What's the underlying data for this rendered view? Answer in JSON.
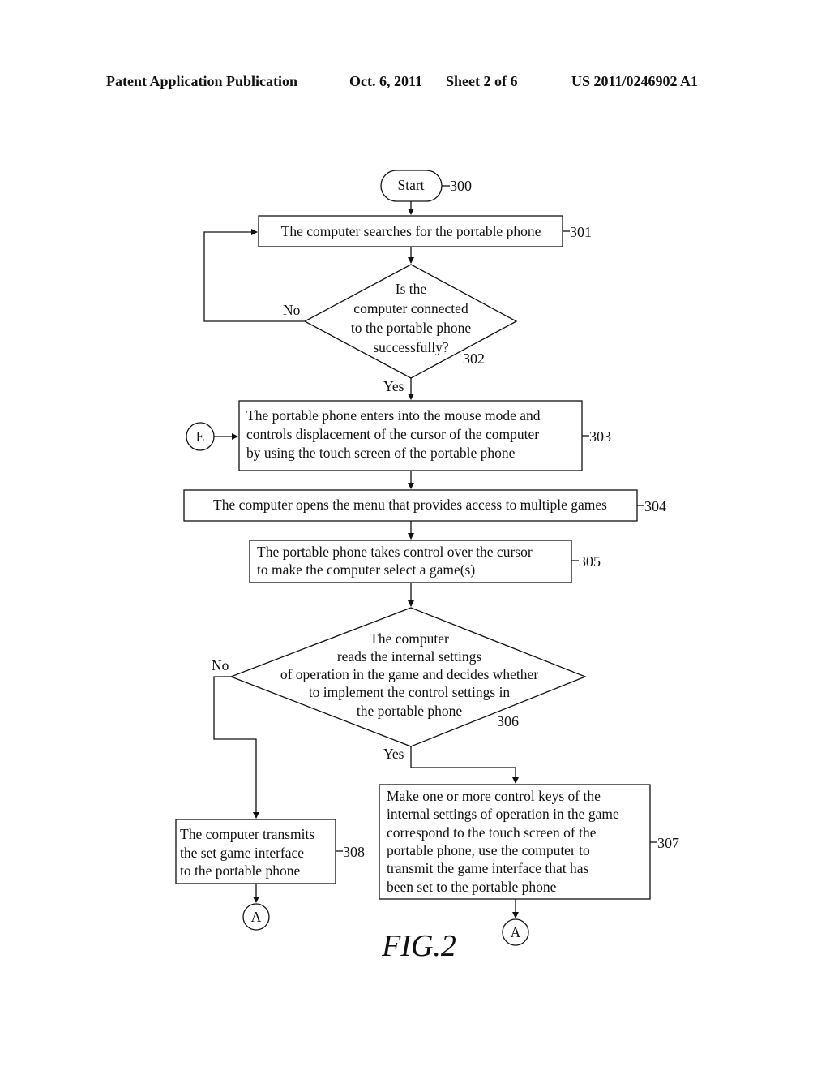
{
  "header": {
    "publication": "Patent Application Publication",
    "date": "Oct. 6, 2011",
    "sheet": "Sheet 2 of 6",
    "number": "US 2011/0246902 A1"
  },
  "flowchart": {
    "start": {
      "label": "Start",
      "ref": "300"
    },
    "step301": {
      "lines": [
        "The computer searches for the portable phone"
      ],
      "ref": "301"
    },
    "decision302": {
      "lines": [
        "Is the",
        "computer connected",
        "to the portable phone",
        "successfully?"
      ],
      "ref": "302",
      "no": "No",
      "yes": "Yes"
    },
    "step303": {
      "lines": [
        "The portable phone enters into the mouse mode and",
        "controls displacement of the cursor of the computer",
        "by using the touch screen of the portable phone"
      ],
      "ref": "303"
    },
    "connector_e": "E",
    "step304": {
      "lines": [
        "The computer opens the menu that provides access to multiple games"
      ],
      "ref": "304"
    },
    "step305": {
      "lines": [
        "The portable phone takes control over the cursor",
        "to make the computer select a game(s)"
      ],
      "ref": "305"
    },
    "decision306": {
      "lines": [
        "The computer",
        "reads the internal settings",
        "of operation in the game and decides whether",
        "to implement the control settings in",
        "the portable phone"
      ],
      "ref": "306",
      "no": "No",
      "yes": "Yes"
    },
    "step307": {
      "lines": [
        "Make one or more control keys of the",
        "internal settings of operation in the game",
        "correspond to the touch screen of the",
        "portable phone, use the computer to",
        "transmit the game interface that has",
        "been set to the portable phone"
      ],
      "ref": "307"
    },
    "step308": {
      "lines": [
        "The computer transmits",
        "the set game interface",
        "to the portable phone"
      ],
      "ref": "308"
    },
    "connector_a_left": "A",
    "connector_a_right": "A"
  },
  "figure_label": "FIG.2"
}
